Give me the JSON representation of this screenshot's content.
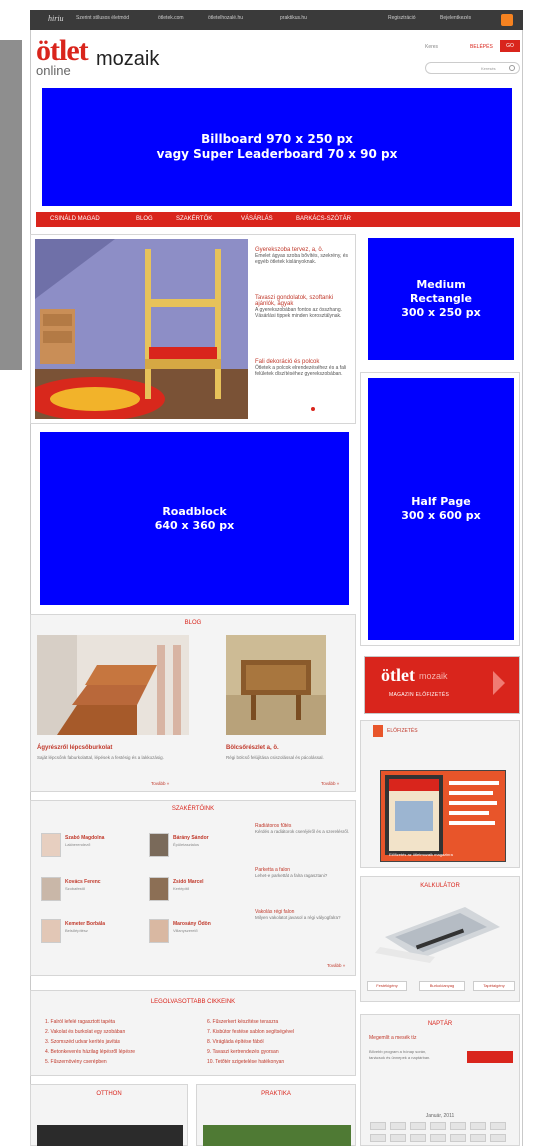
{
  "topbar": {
    "brand": "hiriu",
    "links": [
      "Szerint stílusos életmód",
      "ötletek.com",
      "ötletelhozalé.hu",
      "praktikus.hu"
    ],
    "right": [
      "Regisztráció",
      "Bejelentkezés"
    ]
  },
  "logo": {
    "otlet": "ötlet",
    "mozaik": "mozaik",
    "online": "online"
  },
  "header": {
    "small1": "Keres",
    "small2": "BELÉPÉS",
    "login": "GO",
    "search_placeholder": "Keresés"
  },
  "ads": {
    "billboard": [
      "Billboard 970 x 250 px",
      "vagy Super Leaderboard 70 x 90 px"
    ],
    "medium": [
      "Medium",
      "Rectangle",
      "300 x 250 px"
    ],
    "roadblock": [
      "Roadblock",
      "640 x 360 px"
    ],
    "halfpage": [
      "Half Page",
      "300 x 600 px"
    ]
  },
  "colors": {
    "ad_blue": "#0000ff",
    "brand_red": "#d9251c"
  },
  "nav": [
    "CSINÁLD MAGAD",
    "BLOG",
    "SZAKÉRTŐK",
    "VÁSÁRLÁS",
    "BARKÁCS-SZÓTÁR"
  ],
  "hero": {
    "items": [
      {
        "title": "Gyerekszoba tervez, a, ö.",
        "text": "Emelet ágyas szoba bővítés, szekrény, és egyéb ötletek kislányoknak."
      },
      {
        "title": "Tavaszi gondolatok, szoftanki ajánlók, ágyak",
        "text": "A gyerekszobában fontos az összhang. Vásárlási tippek minden korosztálynak."
      },
      {
        "title": "Fali dekoráció és polcok",
        "text": "Ötletek a polcok elrendezéséhez és a fali felületek díszítéséhez gyerekszobában."
      }
    ]
  },
  "blog": {
    "title": "BLOG",
    "posts": [
      {
        "title": "Ágyrészről lépcsőburkolat",
        "text": "Saját lépcsőnk faburkolattal, lépések a festésig és a lakkozásig."
      },
      {
        "title": "Bölcsőrészlet a, ö.",
        "text": "Régi bölcső felújítása csiszolással és pácolással."
      }
    ],
    "more": "Tovább »"
  },
  "experts": {
    "title": "SZAKÉRTŐINK",
    "people": [
      {
        "name": "Szabó Magdolna",
        "role": "Lakberendező"
      },
      {
        "name": "Bárány Sándor",
        "role": "Épületasztalos"
      },
      {
        "name": "Kovács Ferenc",
        "role": "Szobafestő"
      },
      {
        "name": "Zsidó Marcel",
        "role": "Kertépítő"
      },
      {
        "name": "Kemeter Borbála",
        "role": "Belsőépítész"
      },
      {
        "name": "Marosány Ödön",
        "role": "Villanyszerelő"
      }
    ],
    "questions": [
      {
        "title": "Radiátoros fűtés",
        "text": "Kérdés a radiátorok cseréjéről és a szerelésről."
      },
      {
        "title": "Parketta a falon",
        "text": "Lehet-e parkettát a falra ragasztani?"
      },
      {
        "title": "Vakolás régi falon",
        "text": "Milyen vakolatot javasol a régi vályogfalra?"
      }
    ],
    "more": "Tovább »"
  },
  "popular": {
    "title": "LEGOLVASOTTABB CIKKEINK",
    "left": [
      "1. Falról lefelé ragasztott tapéta",
      "2. Vakolat és burkolat egy szobában",
      "3. Szomszéd udvar kerítés javítás",
      "4. Betonkeverés házilag lépésről lépésre",
      "5. Fűszernövény cserépben"
    ],
    "right": [
      "6. Fűszerkert készítése teraszra",
      "7. Kisbútor festése sablon segítségével",
      "8. Virágláda építése fából",
      "9. Tavaszi kertrendezés gyorsan",
      "10. Tetőtér szigetelése hatékonyan"
    ]
  },
  "bottom_boxes": [
    "OTTHON",
    "PRAKTIKA"
  ],
  "promo": {
    "line1": "ötlet",
    "line2": "mozaik",
    "line3": "MAGAZIN ELŐFIZETÉS"
  },
  "magazine": {
    "title": "ELŐFIZETÉS",
    "cta": "Előfizetés az ötletmozaik magazinra"
  },
  "calculator": {
    "title": "KALKULÁTOR",
    "buttons": [
      "Festékigény",
      "Burkolóanyag",
      "Tapétaigény"
    ]
  },
  "calendar": {
    "title": "NAPTÁR",
    "headline": "Megemlít a mesék tíz",
    "text": "Bővebb program a hónap során, tanácsok és ünnepek a naptárban.",
    "month": "Január, 2011"
  }
}
